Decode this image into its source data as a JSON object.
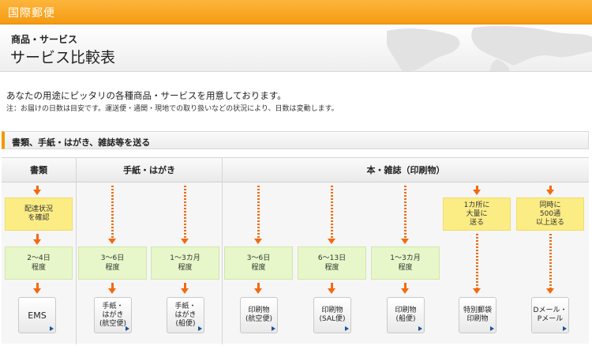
{
  "topbar": {
    "label": "国際郵便"
  },
  "header": {
    "category": "商品・サービス",
    "title": "サービス比較表"
  },
  "intro": {
    "text": "あなたの用途にピッタリの各種商品・サービスを用意しております。",
    "note": "注：お届けの日数は目安です。運送便・通関・現地での取り扱いなどの状況により、日数は変動します。"
  },
  "section": {
    "title": "書類、手紙・はがき、雑誌等を送る"
  },
  "columns": {
    "documents": "書類",
    "letters": "手紙・はがき",
    "books": "本・雑誌（印刷物）"
  },
  "notes": {
    "tracking": {
      "line1": "配達状況",
      "line2": "を確認"
    },
    "bulk_one_place": {
      "line1": "1カ所に",
      "line2": "大量に",
      "line3": "送る"
    },
    "bulk_500": {
      "line1": "同時に",
      "line2": "500通",
      "line3": "以上送る"
    }
  },
  "durations": {
    "d1": {
      "line1": "2〜4日",
      "line2": "程度"
    },
    "d2": {
      "line1": "3〜6日",
      "line2": "程度"
    },
    "d3": {
      "line1": "1〜3カ月",
      "line2": "程度"
    },
    "d4": {
      "line1": "3〜6日",
      "line2": "程度"
    },
    "d5": {
      "line1": "6〜13日",
      "line2": "程度"
    },
    "d6": {
      "line1": "1〜3カ月",
      "line2": "程度"
    }
  },
  "products": {
    "ems": {
      "line1": "EMS"
    },
    "letter_air": {
      "line1": "手紙・",
      "line2": "はがき",
      "line3": "(航空便)"
    },
    "letter_sea": {
      "line1": "手紙・",
      "line2": "はがき",
      "line3": "(船便)"
    },
    "print_air": {
      "line1": "印刷物",
      "line2": "(航空便)"
    },
    "print_sal": {
      "line1": "印刷物",
      "line2": "(SAL便)"
    },
    "print_sea": {
      "line1": "印刷物",
      "line2": "(船便)"
    },
    "m_bag": {
      "line1": "特別郵袋",
      "line2": "印刷物"
    },
    "dmail": {
      "line1": "Dメール・",
      "line2": "Pメール"
    }
  },
  "colors": {
    "accent": "#f39800",
    "arrow": "#f26a10",
    "note_box": "#fbec84",
    "duration_box": "#e7f7c9",
    "link_triangle": "#1a4fa0"
  },
  "icons": {
    "link": "triangle-right-icon",
    "flow": "arrow-down-icon"
  }
}
